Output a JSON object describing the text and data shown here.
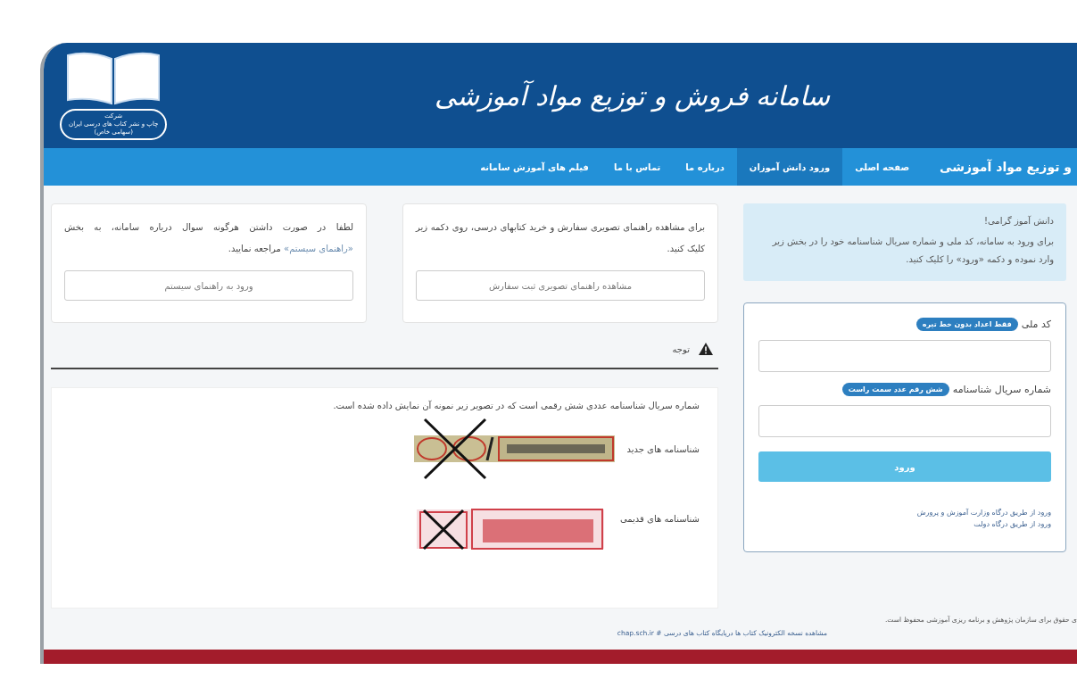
{
  "header": {
    "title": "سامانه فروش و توزیع مواد آموزشی",
    "logo_caption": [
      "شرکت",
      "چاپ و نشر کتاب های درسی ایران",
      "(سهامی خاص)"
    ]
  },
  "nav": [
    {
      "label": "و توزیع مواد آموزشی",
      "kind": "brand",
      "selected": false
    },
    {
      "label": "صفحه اصلی",
      "kind": "link",
      "selected": false
    },
    {
      "label": "ورود دانش آموزان",
      "kind": "link",
      "selected": true
    },
    {
      "label": "درباره ما",
      "kind": "link",
      "selected": false
    },
    {
      "label": "تماس با ما",
      "kind": "link",
      "selected": false
    },
    {
      "label": "فیلم های آموزش سامانه",
      "kind": "link",
      "selected": false
    }
  ],
  "login": {
    "greeting": "دانش آموز گرامی!",
    "intro": "برای ورود به سامانه، کد ملی و شماره سریال شناسنامه خود را در بخش زیر وارد نموده و دکمه «ورود» را کلیک کنید.",
    "fields": [
      {
        "label": "کد ملی",
        "hint": "فقط اعداد بدون خط تیره"
      },
      {
        "label": "شماره سریال شناسنامه",
        "hint": "شش رقم عدد سمت راست"
      }
    ],
    "submit": "ورود",
    "links": [
      "ورود از طریق درگاه وزارت آموزش و پرورش",
      "ورود از طریق درگاه دولت"
    ]
  },
  "cards": [
    {
      "text": "برای مشاهده راهنمای تصویری سفارش و خرید کتابهای درسی، روی دکمه زیر کلیک کنید.",
      "button": "مشاهده راهنمای تصویری ثبت سفارش"
    },
    {
      "text": "لطفا در صورت داشتن هرگونه سوال درباره سامانه، به بخش ",
      "link": "«راهنمای سیستم»",
      "text_after": " مراجعه نمایید.",
      "button": "ورود به راهنمای سیستم"
    }
  ],
  "notice": {
    "title": "توجه",
    "text": "شماره سریال شناسنامه عددی شش رقمی است که در تصویر زیر نمونه آن نمایش داده شده است.",
    "samples": [
      {
        "label": "شناسنامه های جدید",
        "kind": "new"
      },
      {
        "label": "شناسنامه های قدیمی",
        "kind": "old"
      }
    ]
  },
  "footer": {
    "copyright": "ی حقوق برای سازمان پژوهش و برنامه ریزی آموزشی محفوظ است.",
    "link": "مشاهده نسخه الکترونیک کتاب ها درپایگاه کتاب های درسی # chap.sch.ir"
  }
}
